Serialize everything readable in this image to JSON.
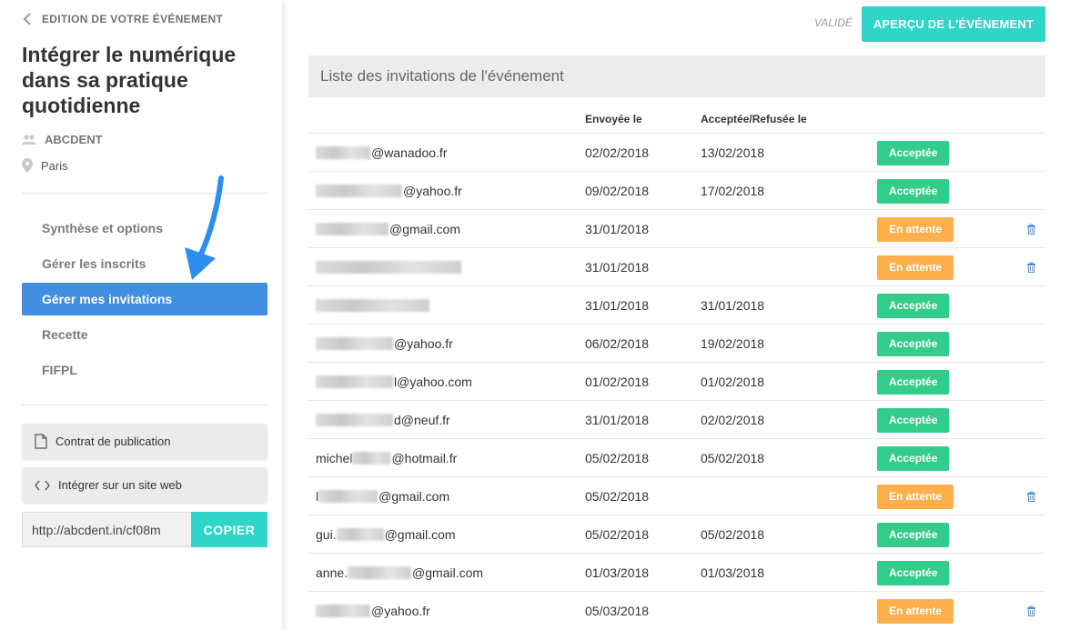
{
  "sidebar": {
    "back_label": "EDITION DE VOTRE ÉVÉNEMENT",
    "event_title": "Intégrer le numérique dans sa pratique quotidienne",
    "organizer": "ABCDENT",
    "city": "Paris",
    "nav": [
      {
        "label": "Synthèse et options",
        "active": false
      },
      {
        "label": "Gérer les inscrits",
        "active": false
      },
      {
        "label": "Gérer mes invitations",
        "active": true
      },
      {
        "label": "Recette",
        "active": false
      },
      {
        "label": "FIFPL",
        "active": false
      }
    ],
    "contract_label": "Contrat de publication",
    "embed_label": "Intégrer sur un site web",
    "share_url": "http://abcdent.in/cf08m",
    "copy_label": "COPIER"
  },
  "header": {
    "status": "VALIDÉ",
    "preview_label": "APERÇU DE L'ÉVÉNEMENT"
  },
  "invitations": {
    "title": "Liste des invitations de l'événement",
    "columns": {
      "sent": "Envoyée le",
      "response": "Acceptée/Refusée le"
    },
    "rows": [
      {
        "prefix": "",
        "domain": "@wanadoo.fr",
        "sent": "02/02/2018",
        "response": "13/02/2018",
        "status": "Acceptée",
        "deletable": false
      },
      {
        "prefix": "",
        "domain": "@yahoo.fr",
        "sent": "09/02/2018",
        "response": "17/02/2018",
        "status": "Acceptée",
        "deletable": false
      },
      {
        "prefix": "",
        "domain": "@gmail.com",
        "sent": "31/01/2018",
        "response": "",
        "status": "En attente",
        "deletable": true
      },
      {
        "prefix": "",
        "domain": "",
        "sent": "31/01/2018",
        "response": "",
        "status": "En attente",
        "deletable": true
      },
      {
        "prefix": "",
        "domain": "",
        "sent": "31/01/2018",
        "response": "31/01/2018",
        "status": "Acceptée",
        "deletable": false
      },
      {
        "prefix": "",
        "domain": "@yahoo.fr",
        "sent": "06/02/2018",
        "response": "19/02/2018",
        "status": "Acceptée",
        "deletable": false
      },
      {
        "prefix": "",
        "domain": "l@yahoo.com",
        "sent": "01/02/2018",
        "response": "01/02/2018",
        "status": "Acceptée",
        "deletable": false
      },
      {
        "prefix": "",
        "domain": "d@neuf.fr",
        "sent": "31/01/2018",
        "response": "02/02/2018",
        "status": "Acceptée",
        "deletable": false
      },
      {
        "prefix": "michel",
        "domain": "@hotmail.fr",
        "sent": "05/02/2018",
        "response": "05/02/2018",
        "status": "Acceptée",
        "deletable": false
      },
      {
        "prefix": "l",
        "domain": "@gmail.com",
        "sent": "05/02/2018",
        "response": "",
        "status": "En attente",
        "deletable": true
      },
      {
        "prefix": "gui.",
        "domain": "@gmail.com",
        "sent": "05/02/2018",
        "response": "05/02/2018",
        "status": "Acceptée",
        "deletable": false
      },
      {
        "prefix": "anne.",
        "domain": "@gmail.com",
        "sent": "01/03/2018",
        "response": "01/03/2018",
        "status": "Acceptée",
        "deletable": false
      },
      {
        "prefix": "",
        "domain": "@yahoo.fr",
        "sent": "05/03/2018",
        "response": "",
        "status": "En attente",
        "deletable": true
      }
    ]
  },
  "colors": {
    "accent": "#2fd6c8",
    "nav_active": "#3f8ee0",
    "accepted": "#33cc8a",
    "pending": "#ffb04d",
    "annotation_arrow": "#2e8ef0"
  }
}
